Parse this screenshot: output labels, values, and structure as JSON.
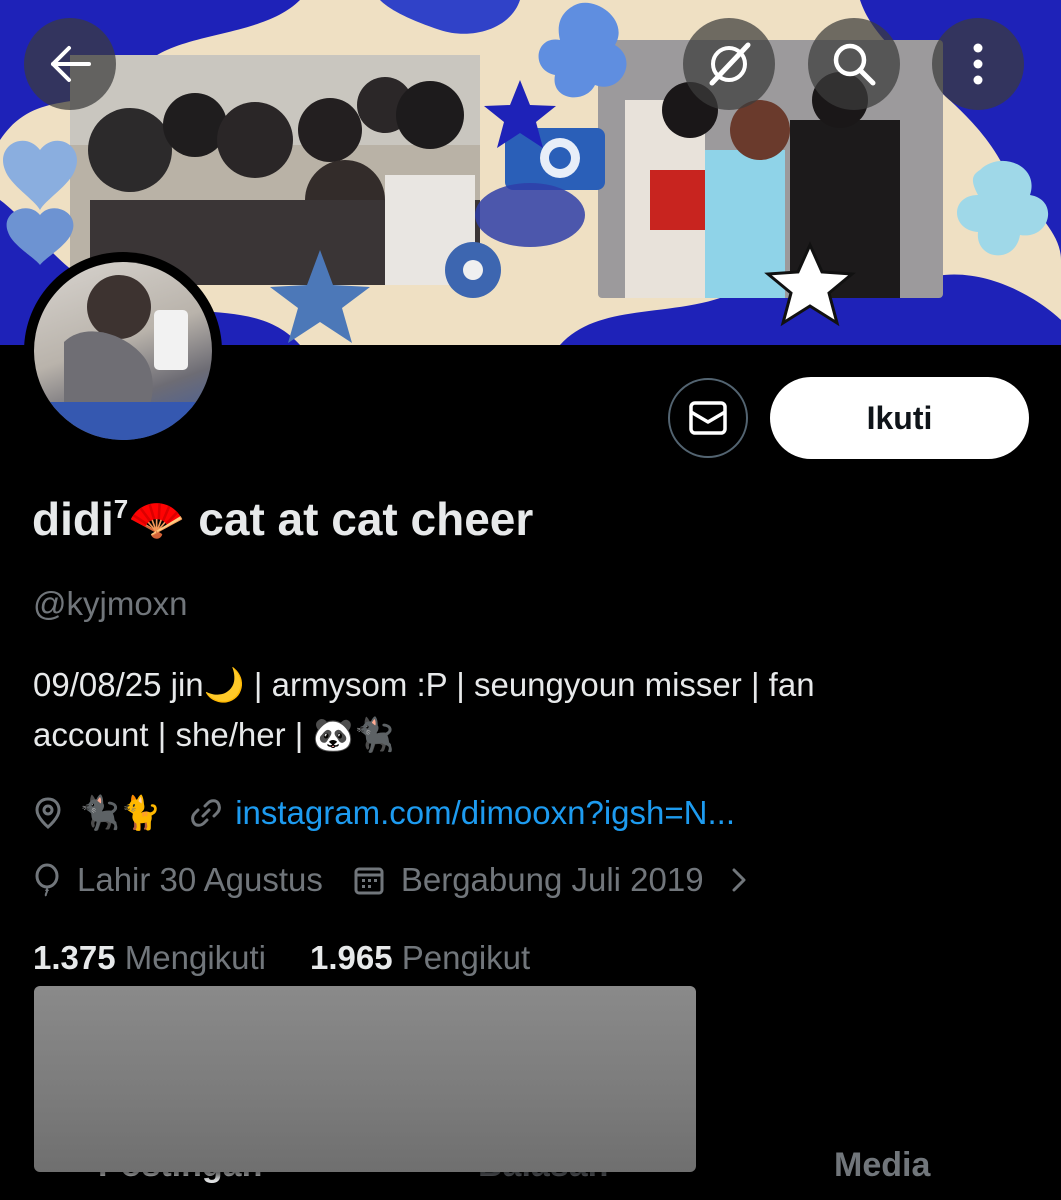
{
  "profile": {
    "display_name": "didi",
    "display_superscript": "7",
    "display_emoji": "🪭",
    "display_suffix": " cat at cat cheer",
    "handle": "@kyjmoxn",
    "bio_line1": "09/08/25 jin🌙 | armysom :P | seungyoun misser | fan",
    "bio_line2": "account | she/her | 🐼🐈‍⬛",
    "location": "🐈‍⬛🐈",
    "website": "instagram.com/dimooxn?igsh=N...",
    "birthday": "Lahir 30 Agustus",
    "joined": "Bergabung Juli 2019",
    "following_count": "1.375",
    "following_label": "Mengikuti",
    "followers_count": "1.965",
    "followers_label": "Pengikut"
  },
  "actions": {
    "follow_label": "Ikuti"
  },
  "tabs": [
    {
      "label": "Postingan"
    },
    {
      "label": "Balasan"
    },
    {
      "label": "Media"
    }
  ],
  "icons": {
    "back": "arrow-left-icon",
    "grok": "grok-icon",
    "search": "search-icon",
    "more": "more-vertical-icon",
    "message": "envelope-icon",
    "location": "location-pin-icon",
    "link": "link-icon",
    "birthday": "balloon-icon",
    "calendar": "calendar-icon",
    "chevron": "chevron-right-icon"
  },
  "colors": {
    "background": "#000000",
    "text_primary": "#e7e9ea",
    "text_secondary": "#71767b",
    "link": "#1d9bf0",
    "follow_button_bg": "#ffffff",
    "banner_blue": "#1e22b8",
    "banner_beige": "#efe0c3"
  }
}
